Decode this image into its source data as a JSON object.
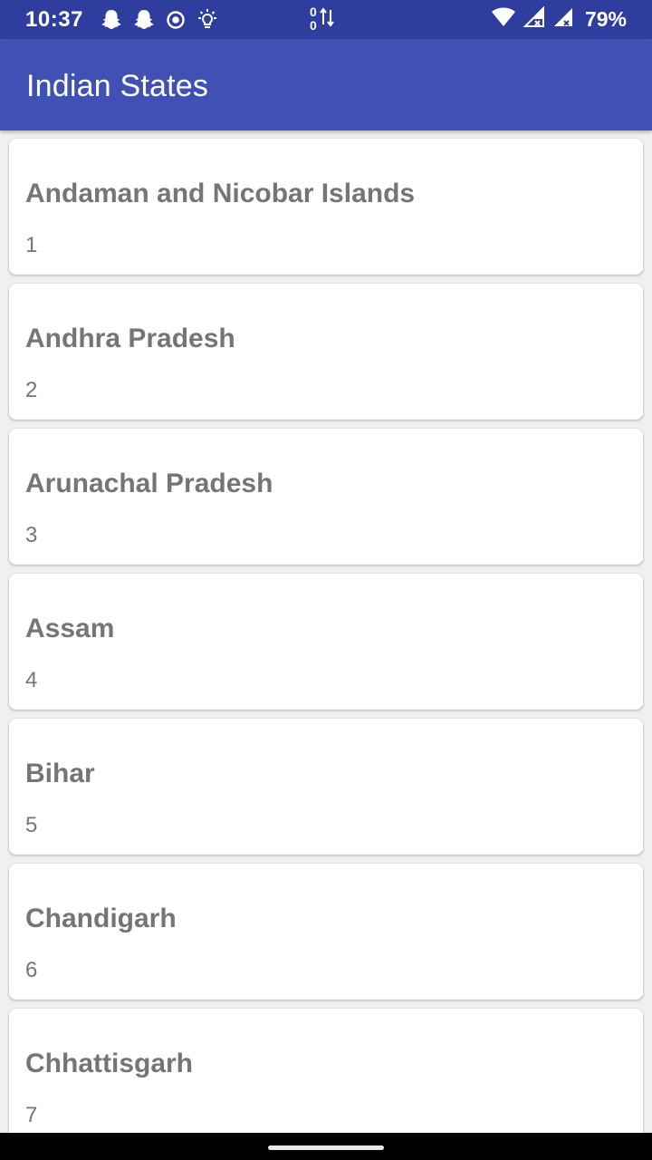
{
  "status_bar": {
    "time": "10:37",
    "data_counts": [
      "0",
      "0"
    ],
    "battery": "79%",
    "left_icons": [
      "snapchat-icon",
      "snapchat-icon",
      "record-icon",
      "brightness-icon"
    ],
    "right_icons": [
      "wifi-icon",
      "signal-icon",
      "signal-icon"
    ]
  },
  "app_bar": {
    "title": "Indian States",
    "color": "#3f51b5"
  },
  "states": [
    {
      "name": "Andaman and Nicobar Islands",
      "number": "1"
    },
    {
      "name": "Andhra Pradesh",
      "number": "2"
    },
    {
      "name": "Arunachal Pradesh",
      "number": "3"
    },
    {
      "name": "Assam",
      "number": "4"
    },
    {
      "name": "Bihar",
      "number": "5"
    },
    {
      "name": "Chandigarh",
      "number": "6"
    },
    {
      "name": "Chhattisgarh",
      "number": "7"
    }
  ]
}
